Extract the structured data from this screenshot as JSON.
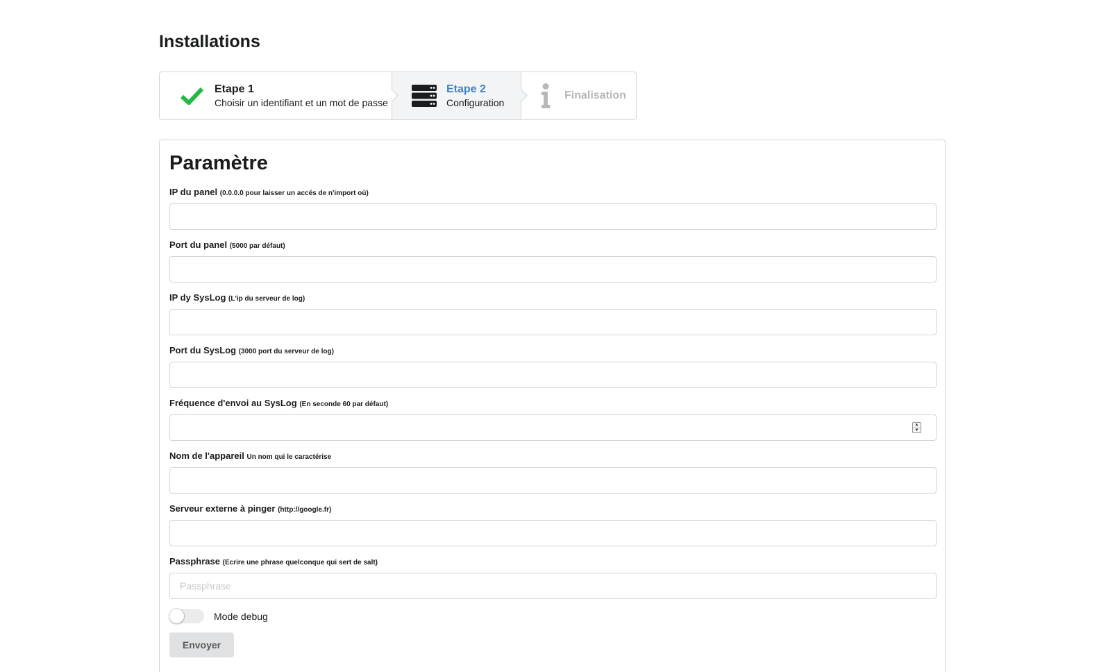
{
  "page": {
    "title": "Installations"
  },
  "steps": [
    {
      "title": "Etape 1",
      "description": "Choisir un identifiant et un mot de passe",
      "icon": "checkmark-icon",
      "state": "completed"
    },
    {
      "title": "Etape 2",
      "description": "Configuration",
      "icon": "server-icon",
      "state": "active"
    },
    {
      "title": "Finalisation",
      "description": "",
      "icon": "info-icon",
      "state": "disabled"
    }
  ],
  "form": {
    "title": "Paramètre",
    "fields": [
      {
        "label": "IP du panel",
        "hint": "(0.0.0.0 pour laisser un accés de n'import où)",
        "value": "",
        "placeholder": "",
        "type": "text"
      },
      {
        "label": "Port du panel",
        "hint": "(5000 par défaut)",
        "value": "",
        "placeholder": "",
        "type": "text"
      },
      {
        "label": "IP dy SysLog",
        "hint": "(L'ip du serveur de log)",
        "value": "",
        "placeholder": "",
        "type": "text"
      },
      {
        "label": "Port du SysLog",
        "hint": "(3000 port du serveur de log)",
        "value": "",
        "placeholder": "",
        "type": "text"
      },
      {
        "label": "Fréquence d'envoi au SysLog",
        "hint": "(En seconde 60 par défaut)",
        "value": "",
        "placeholder": "",
        "type": "number"
      },
      {
        "label": "Nom de l'appareil",
        "hint": "Un nom qui le caractérise",
        "value": "",
        "placeholder": "",
        "type": "text"
      },
      {
        "label": "Serveur externe à pinger",
        "hint": "(http://google.fr)",
        "value": "",
        "placeholder": "",
        "type": "text"
      },
      {
        "label": "Passphrase",
        "hint": "(Ecrire une phrase quelconque qui sert de salt)",
        "value": "",
        "placeholder": "Passphrase",
        "type": "text"
      }
    ],
    "debug_toggle": {
      "label": "Mode debug",
      "checked": false
    },
    "submit_label": "Envoyer"
  },
  "colors": {
    "check": "#21ba45",
    "active_step": "#4183c4",
    "disabled_step": "#b8b8b9",
    "border": "#d4d4d5",
    "button_bg": "#e0e1e2"
  }
}
